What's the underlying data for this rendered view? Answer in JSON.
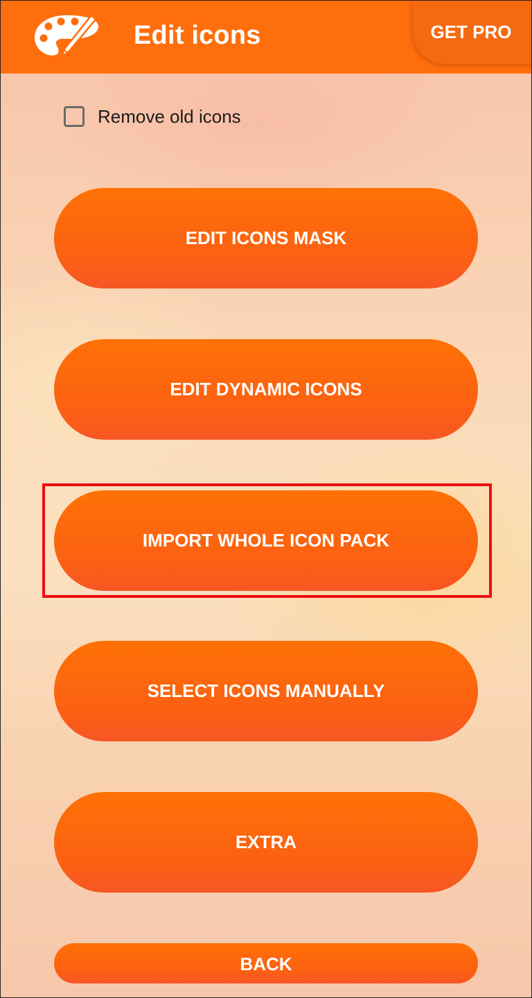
{
  "app_bar": {
    "title": "Edit icons",
    "icon": "palette-icon",
    "get_pro_label": "GET PRO",
    "color": "#ff6e0c"
  },
  "options": {
    "remove_old_icons_label": "Remove old icons",
    "remove_old_icons_checked": false
  },
  "actions": {
    "edit_icons_mask": "EDIT ICONS MASK",
    "edit_dynamic_icons": "EDIT DYNAMIC ICONS",
    "import_whole_icon_pack": "IMPORT WHOLE ICON PACK",
    "select_icons_manually": "SELECT ICONS MANUALLY",
    "extra": "EXTRA",
    "back": "BACK"
  },
  "highlight": {
    "target": "import_whole_icon_pack",
    "color": "#ee0d0d"
  },
  "colors": {
    "button": "#fb6013",
    "button_text": "#ffffff"
  }
}
